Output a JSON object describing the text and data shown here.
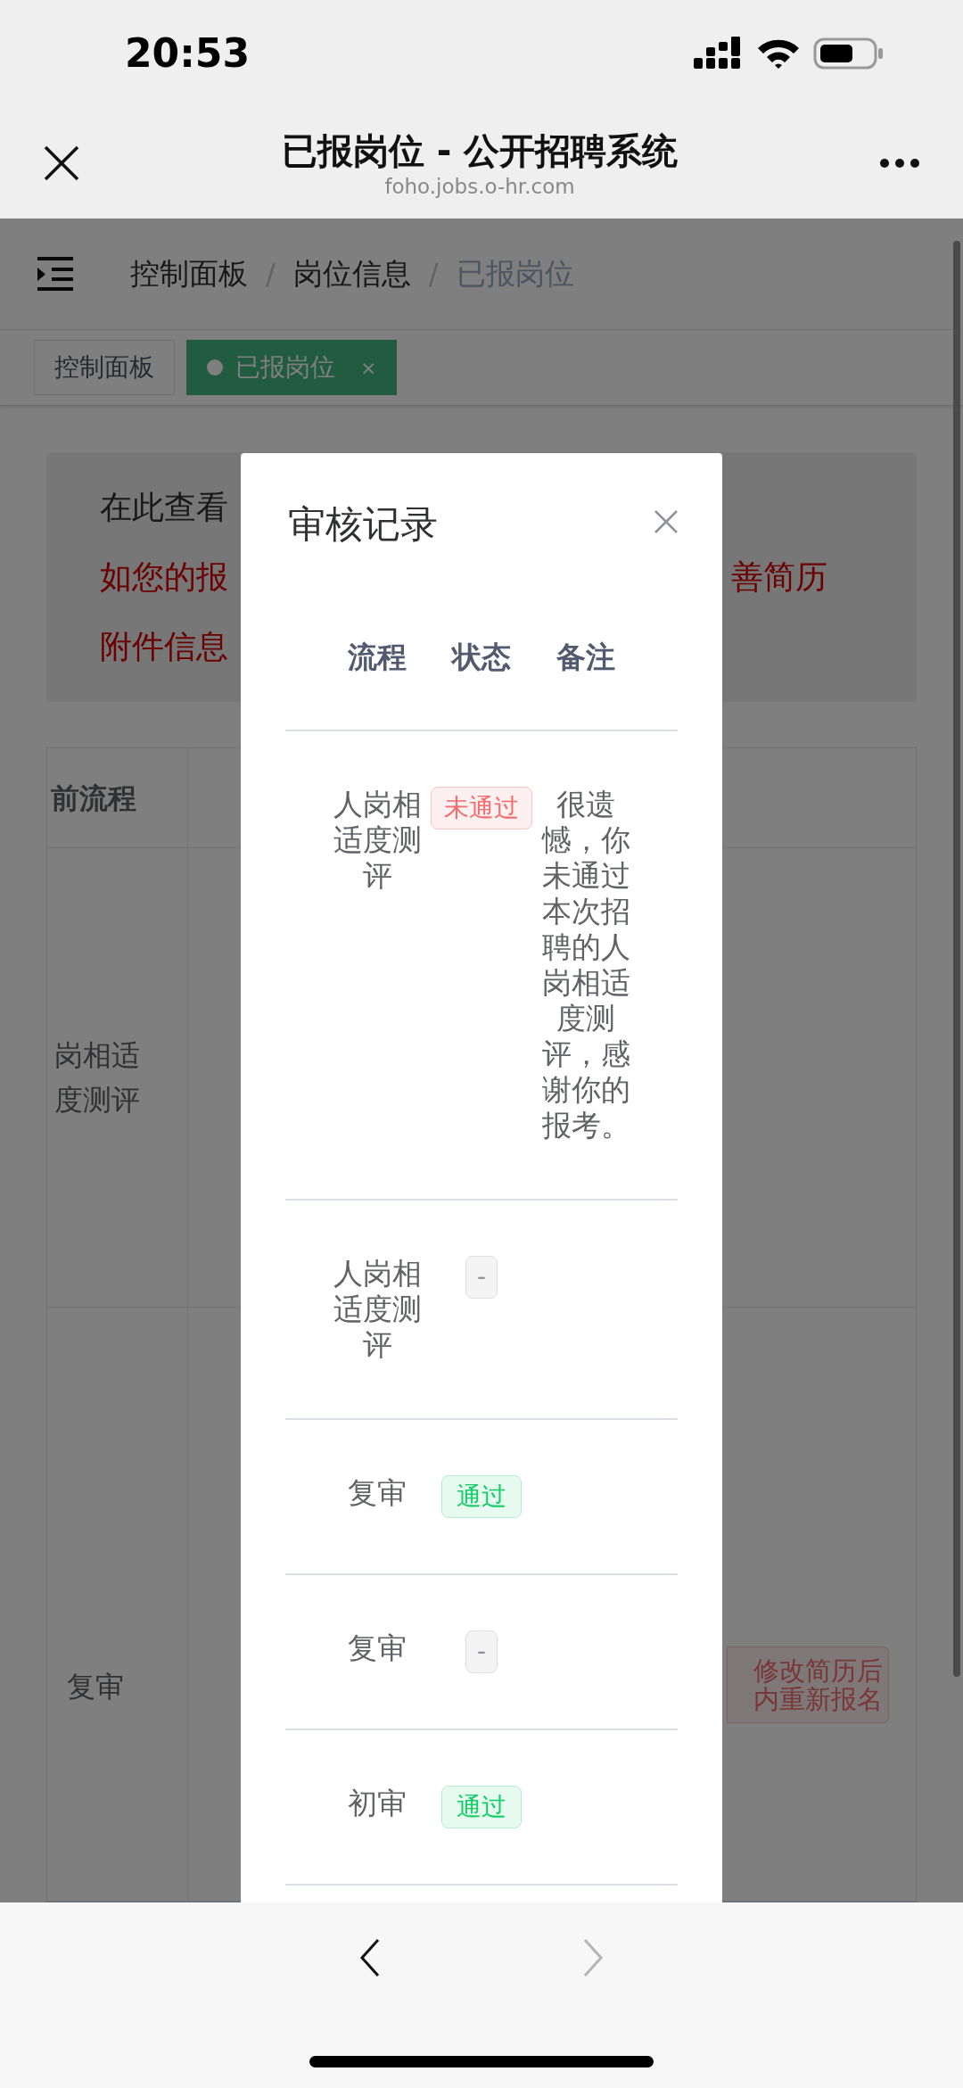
{
  "status_bar": {
    "time": "20:53"
  },
  "header": {
    "title": "已报岗位 - 公开招聘系统",
    "url": "foho.jobs.o-hr.com"
  },
  "breadcrumb": [
    {
      "label": "控制面板",
      "current": false
    },
    {
      "separator": "/",
      "label": "岗位信息",
      "current": false
    },
    {
      "separator": "/",
      "label": "已报岗位",
      "current": true
    }
  ],
  "tags": [
    {
      "label": "控制面板",
      "selected": false
    },
    {
      "label": "已报岗位",
      "selected": true,
      "close_mark": "×"
    }
  ],
  "notice": {
    "line_1": "在此查看",
    "line_2_start": "如您的报",
    "line_2_end": "善简历",
    "line_3": "附件信息"
  },
  "table": {
    "header": "前流程",
    "rows": [
      {
        "stage_lines": [
          "岗相适",
          "度测评"
        ]
      },
      {
        "stage_lines": [
          "复审"
        ],
        "action_lines": [
          "修改简历后",
          "内重新报名"
        ]
      }
    ]
  },
  "dialog": {
    "title": "审核记录",
    "columns": [
      "流程",
      "状态",
      "备注"
    ],
    "rows": [
      {
        "stage": "人岗相适度测评",
        "status": {
          "kind": "rejected",
          "text": "未通过"
        },
        "note": "很遗憾，你未通过本次招聘的人岗相适度测评，感谢你的报考。"
      },
      {
        "stage": "人岗相适度测评",
        "status": {
          "kind": "none",
          "text": "-"
        }
      },
      {
        "stage": "复审",
        "status": {
          "kind": "passed",
          "text": "通过"
        }
      },
      {
        "stage": "复审",
        "status": {
          "kind": "none",
          "text": "-"
        }
      },
      {
        "stage": "初审",
        "status": {
          "kind": "passed",
          "text": "通过"
        }
      }
    ]
  },
  "nav": {
    "back": {
      "disabled": false
    },
    "forward": {
      "disabled": true
    }
  }
}
